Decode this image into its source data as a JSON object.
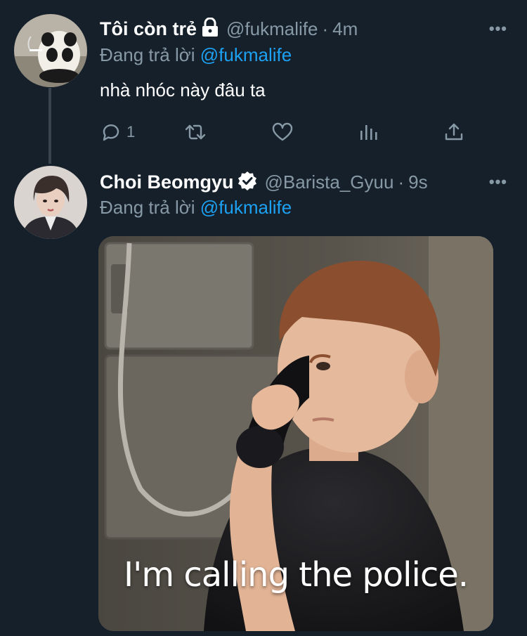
{
  "tweets": [
    {
      "display_name": "Tôi còn trẻ",
      "handle": "@fukmalife",
      "time": "4m",
      "reply_prefix": "Đang trả lời",
      "reply_to": "@fukmalife",
      "text": "nhà nhóc này đâu ta",
      "reply_count": "1",
      "avatar": "panda-avatar",
      "badge_icon": "lock-icon"
    },
    {
      "display_name": "Choi Beomgyu",
      "handle": "@Barista_Gyuu",
      "time": "9s",
      "reply_prefix": "Đang trả lời",
      "reply_to": "@fukmalife",
      "avatar": "person-avatar",
      "badge_icon": "verified-icon",
      "media_caption": "I'm calling the police."
    }
  ],
  "colors": {
    "background": "#15202b",
    "muted": "#8899a6",
    "link": "#1da1f2",
    "text": "#ffffff"
  }
}
